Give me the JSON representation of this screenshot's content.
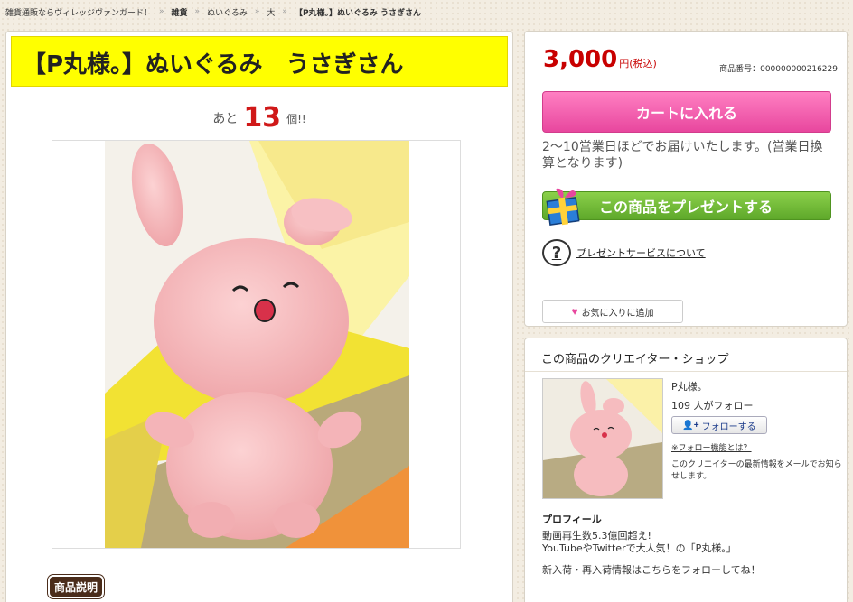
{
  "breadcrumb": {
    "items": [
      {
        "label": "雑貨通販ならヴィレッジヴァンガード！",
        "bold": false
      },
      {
        "label": "雑貨",
        "bold": true
      },
      {
        "label": "ぬいぐるみ",
        "bold": false
      },
      {
        "label": "大",
        "bold": false
      },
      {
        "label": "【P丸様。】ぬいぐるみ うさぎさん",
        "bold": true
      }
    ],
    "separator": "»"
  },
  "product": {
    "title": "【P丸様。】ぬいぐるみ　うさぎさん",
    "stock_prefix": "あと",
    "stock_count": "13",
    "stock_suffix": "個!!",
    "description_badge": "商品説明"
  },
  "purchase": {
    "price": "3,000",
    "price_unit": "円(税込)",
    "product_number": "商品番号：000000000216229",
    "cart_button": "カートに入れる",
    "delivery_text": "2〜10営業日ほどでお届けいたします。(営業日換算となります)",
    "gift_button": "この商品をプレゼントする",
    "gift_info_link": "プレゼントサービスについて",
    "gift_info_icon": "?",
    "favorite_button": "お気に入りに追加"
  },
  "creator": {
    "heading": "この商品のクリエイター・ショップ",
    "shop_name": "P丸様。",
    "follower_count": "109 人がフォロー",
    "follow_button": "フォローする",
    "follow_about": "※フォロー機能とは？",
    "note": "このクリエイターの最新情報をメールでお知らせします。",
    "profile_heading": "プロフィール",
    "profile_lines": [
      "動画再生数5.3億回超え!",
      "YouTubeやTwitterで大人気！の「P丸様。」",
      "新入荷・再入荷情報はこちらをフォローしてね！"
    ]
  },
  "colors": {
    "title_bg": "#ffff00",
    "price": "#c80000",
    "cart_button": "#e8479e",
    "gift_button": "#5ea82a",
    "plush_pink": "#f5b5b8"
  }
}
